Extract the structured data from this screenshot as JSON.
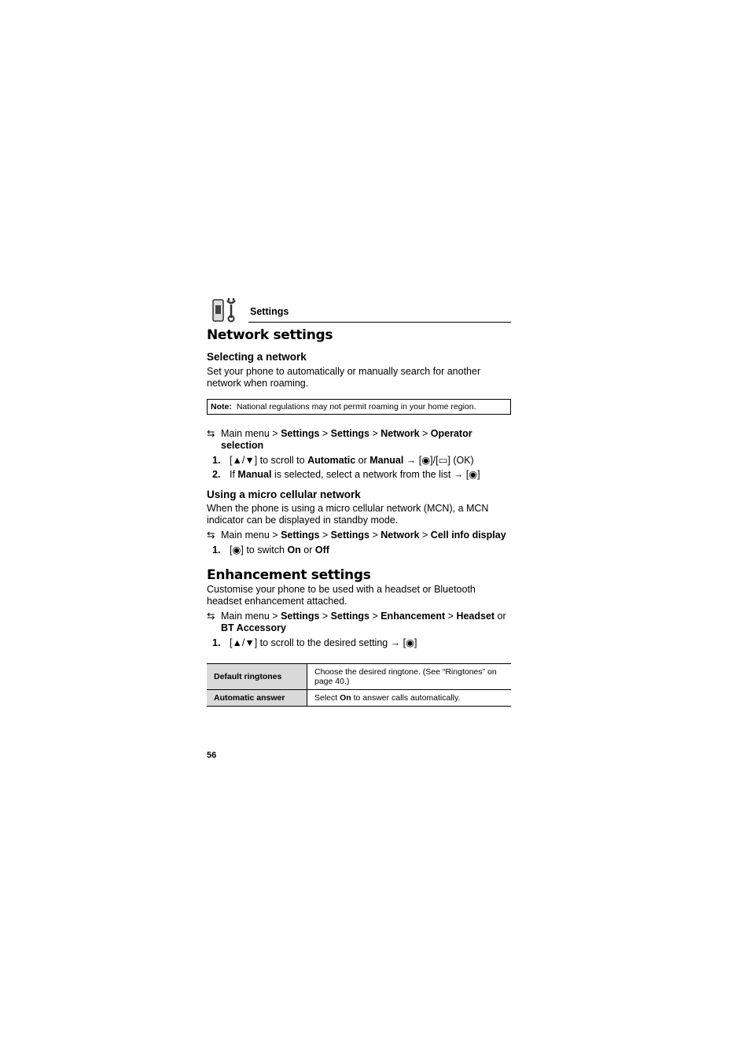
{
  "header": {
    "icon": "settings-phone-wrench-icon",
    "title": "Settings"
  },
  "sections": {
    "network": {
      "title": "Network settings",
      "selecting": {
        "title": "Selecting a network",
        "body": "Set your phone to automatically or manually search for another network when roaming.",
        "note_label": "Note:",
        "note_text": "National regulations may not permit roaming in your home region.",
        "path_prefix": "Main menu > ",
        "path": [
          "Settings",
          "Settings",
          "Network",
          "Operator selection"
        ],
        "steps": [
          {
            "num": "1.",
            "pre": "[▲/▼] to scroll to ",
            "b1": "Automatic",
            "mid": " or ",
            "b2": "Manual",
            "post": " → [◉]/[▭] (OK)"
          },
          {
            "num": "2.",
            "pre": "If ",
            "b1": "Manual",
            "post": " is selected, select a network from the list → [◉]"
          }
        ]
      },
      "micro": {
        "title": "Using a micro cellular network",
        "body": "When the phone is using a micro cellular network (MCN), a MCN indicator can be displayed in standby mode.",
        "path_prefix": "Main menu > ",
        "path": [
          "Settings",
          "Settings",
          "Network",
          "Cell info display"
        ],
        "steps": [
          {
            "num": "1.",
            "pre": "[◉] to switch ",
            "b1": "On",
            "mid": " or ",
            "b2": "Off"
          }
        ]
      }
    },
    "enhancement": {
      "title": "Enhancement settings",
      "body": "Customise your phone to be used with a headset or Bluetooth headset enhancement attached.",
      "path_prefix": "Main menu > ",
      "path": [
        "Settings",
        "Settings",
        "Enhancement",
        "Headset"
      ],
      "path_or": " or ",
      "path_alt": "BT Accessory",
      "steps": [
        {
          "num": "1.",
          "pre": "[▲/▼] to scroll to the desired setting → [◉]"
        }
      ],
      "table": [
        {
          "key": "Default ringtones",
          "value": "Choose the desired ringtone. (See “Ringtones” on page 40.)"
        },
        {
          "key": "Automatic answer",
          "pre": "Select ",
          "bold": "On",
          "post": " to answer calls automatically."
        }
      ]
    }
  },
  "page_number": "56"
}
